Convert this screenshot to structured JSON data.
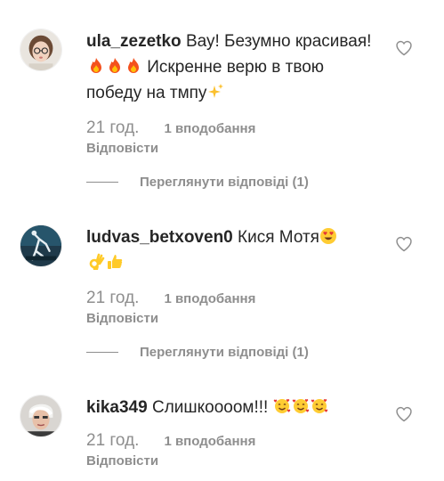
{
  "comments": [
    {
      "username": "ula_zezetko",
      "text_1": "Вау! Безумно красивая!",
      "emoji_1": [
        "fire-emoji",
        "fire-emoji",
        "fire-emoji"
      ],
      "text_2": " Искренне верю в твою победу на тмпу",
      "emoji_2": [
        "sparkles-emoji"
      ],
      "time": "21 год.",
      "likes": "1 вподобання",
      "reply": "Відповісти",
      "view_replies": "Переглянути відповіді (1)"
    },
    {
      "username": "ludvas_betxoven0",
      "text_1": "Кися Мотя",
      "emoji_1": [
        "heart-eyes-emoji",
        "ok-hand-emoji",
        "thumbs-up-emoji"
      ],
      "time": "21 год.",
      "likes": "1 вподобання",
      "reply": "Відповісти",
      "view_replies": "Переглянути відповіді (1)"
    },
    {
      "username": "kika349",
      "text_1": "Слишкоооом!!!",
      "emoji_1": [
        "smiling-hearts-emoji",
        "smiling-hearts-emoji",
        "smiling-hearts-emoji"
      ],
      "time": "21 год.",
      "likes": "1 вподобання",
      "reply": "Відповісти"
    }
  ],
  "colors": {
    "text": "#262626",
    "secondary": "#8e8e8e",
    "background": "#ffffff"
  }
}
